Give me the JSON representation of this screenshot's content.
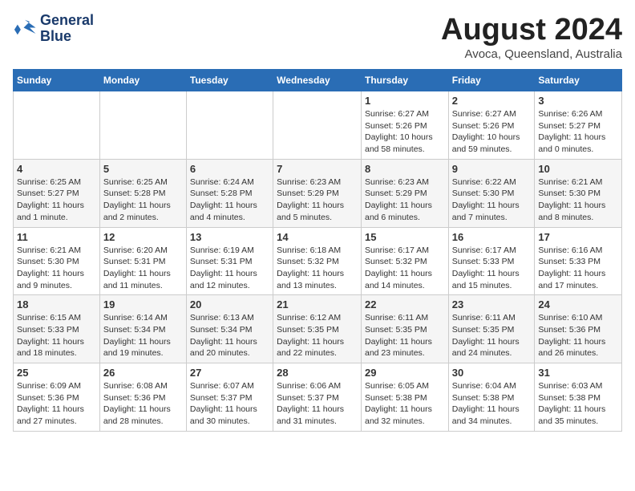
{
  "header": {
    "logo_line1": "General",
    "logo_line2": "Blue",
    "month": "August 2024",
    "location": "Avoca, Queensland, Australia"
  },
  "days_of_week": [
    "Sunday",
    "Monday",
    "Tuesday",
    "Wednesday",
    "Thursday",
    "Friday",
    "Saturday"
  ],
  "weeks": [
    [
      {
        "day": "",
        "text": ""
      },
      {
        "day": "",
        "text": ""
      },
      {
        "day": "",
        "text": ""
      },
      {
        "day": "",
        "text": ""
      },
      {
        "day": "1",
        "text": "Sunrise: 6:27 AM\nSunset: 5:26 PM\nDaylight: 10 hours and 58 minutes."
      },
      {
        "day": "2",
        "text": "Sunrise: 6:27 AM\nSunset: 5:26 PM\nDaylight: 10 hours and 59 minutes."
      },
      {
        "day": "3",
        "text": "Sunrise: 6:26 AM\nSunset: 5:27 PM\nDaylight: 11 hours and 0 minutes."
      }
    ],
    [
      {
        "day": "4",
        "text": "Sunrise: 6:25 AM\nSunset: 5:27 PM\nDaylight: 11 hours and 1 minute."
      },
      {
        "day": "5",
        "text": "Sunrise: 6:25 AM\nSunset: 5:28 PM\nDaylight: 11 hours and 2 minutes."
      },
      {
        "day": "6",
        "text": "Sunrise: 6:24 AM\nSunset: 5:28 PM\nDaylight: 11 hours and 4 minutes."
      },
      {
        "day": "7",
        "text": "Sunrise: 6:23 AM\nSunset: 5:29 PM\nDaylight: 11 hours and 5 minutes."
      },
      {
        "day": "8",
        "text": "Sunrise: 6:23 AM\nSunset: 5:29 PM\nDaylight: 11 hours and 6 minutes."
      },
      {
        "day": "9",
        "text": "Sunrise: 6:22 AM\nSunset: 5:30 PM\nDaylight: 11 hours and 7 minutes."
      },
      {
        "day": "10",
        "text": "Sunrise: 6:21 AM\nSunset: 5:30 PM\nDaylight: 11 hours and 8 minutes."
      }
    ],
    [
      {
        "day": "11",
        "text": "Sunrise: 6:21 AM\nSunset: 5:30 PM\nDaylight: 11 hours and 9 minutes."
      },
      {
        "day": "12",
        "text": "Sunrise: 6:20 AM\nSunset: 5:31 PM\nDaylight: 11 hours and 11 minutes."
      },
      {
        "day": "13",
        "text": "Sunrise: 6:19 AM\nSunset: 5:31 PM\nDaylight: 11 hours and 12 minutes."
      },
      {
        "day": "14",
        "text": "Sunrise: 6:18 AM\nSunset: 5:32 PM\nDaylight: 11 hours and 13 minutes."
      },
      {
        "day": "15",
        "text": "Sunrise: 6:17 AM\nSunset: 5:32 PM\nDaylight: 11 hours and 14 minutes."
      },
      {
        "day": "16",
        "text": "Sunrise: 6:17 AM\nSunset: 5:33 PM\nDaylight: 11 hours and 15 minutes."
      },
      {
        "day": "17",
        "text": "Sunrise: 6:16 AM\nSunset: 5:33 PM\nDaylight: 11 hours and 17 minutes."
      }
    ],
    [
      {
        "day": "18",
        "text": "Sunrise: 6:15 AM\nSunset: 5:33 PM\nDaylight: 11 hours and 18 minutes."
      },
      {
        "day": "19",
        "text": "Sunrise: 6:14 AM\nSunset: 5:34 PM\nDaylight: 11 hours and 19 minutes."
      },
      {
        "day": "20",
        "text": "Sunrise: 6:13 AM\nSunset: 5:34 PM\nDaylight: 11 hours and 20 minutes."
      },
      {
        "day": "21",
        "text": "Sunrise: 6:12 AM\nSunset: 5:35 PM\nDaylight: 11 hours and 22 minutes."
      },
      {
        "day": "22",
        "text": "Sunrise: 6:11 AM\nSunset: 5:35 PM\nDaylight: 11 hours and 23 minutes."
      },
      {
        "day": "23",
        "text": "Sunrise: 6:11 AM\nSunset: 5:35 PM\nDaylight: 11 hours and 24 minutes."
      },
      {
        "day": "24",
        "text": "Sunrise: 6:10 AM\nSunset: 5:36 PM\nDaylight: 11 hours and 26 minutes."
      }
    ],
    [
      {
        "day": "25",
        "text": "Sunrise: 6:09 AM\nSunset: 5:36 PM\nDaylight: 11 hours and 27 minutes."
      },
      {
        "day": "26",
        "text": "Sunrise: 6:08 AM\nSunset: 5:36 PM\nDaylight: 11 hours and 28 minutes."
      },
      {
        "day": "27",
        "text": "Sunrise: 6:07 AM\nSunset: 5:37 PM\nDaylight: 11 hours and 30 minutes."
      },
      {
        "day": "28",
        "text": "Sunrise: 6:06 AM\nSunset: 5:37 PM\nDaylight: 11 hours and 31 minutes."
      },
      {
        "day": "29",
        "text": "Sunrise: 6:05 AM\nSunset: 5:38 PM\nDaylight: 11 hours and 32 minutes."
      },
      {
        "day": "30",
        "text": "Sunrise: 6:04 AM\nSunset: 5:38 PM\nDaylight: 11 hours and 34 minutes."
      },
      {
        "day": "31",
        "text": "Sunrise: 6:03 AM\nSunset: 5:38 PM\nDaylight: 11 hours and 35 minutes."
      }
    ]
  ]
}
